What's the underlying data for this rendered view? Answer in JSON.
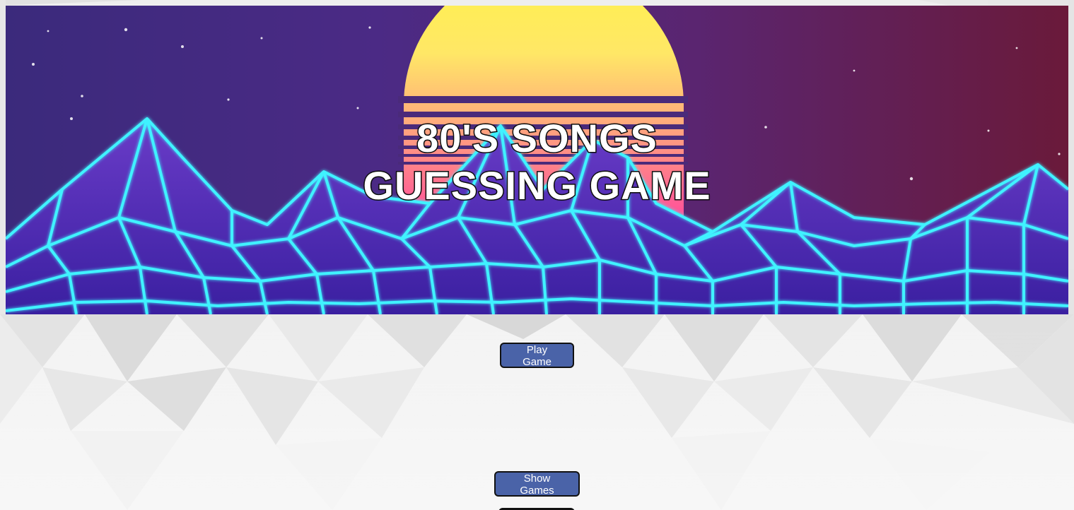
{
  "banner": {
    "title_line1": "80'S SONGS",
    "title_line2": "GUESSING GAME"
  },
  "buttons": {
    "play_game": "Play Game",
    "show_games": "Show Games"
  },
  "colors": {
    "button_bg": "#4a63a8",
    "button_border": "#111111",
    "sky_top": "#3a1c6b",
    "sun_top": "#fff04a",
    "sun_bottom": "#ff6aa0",
    "grid_glow": "#34f4ff"
  }
}
